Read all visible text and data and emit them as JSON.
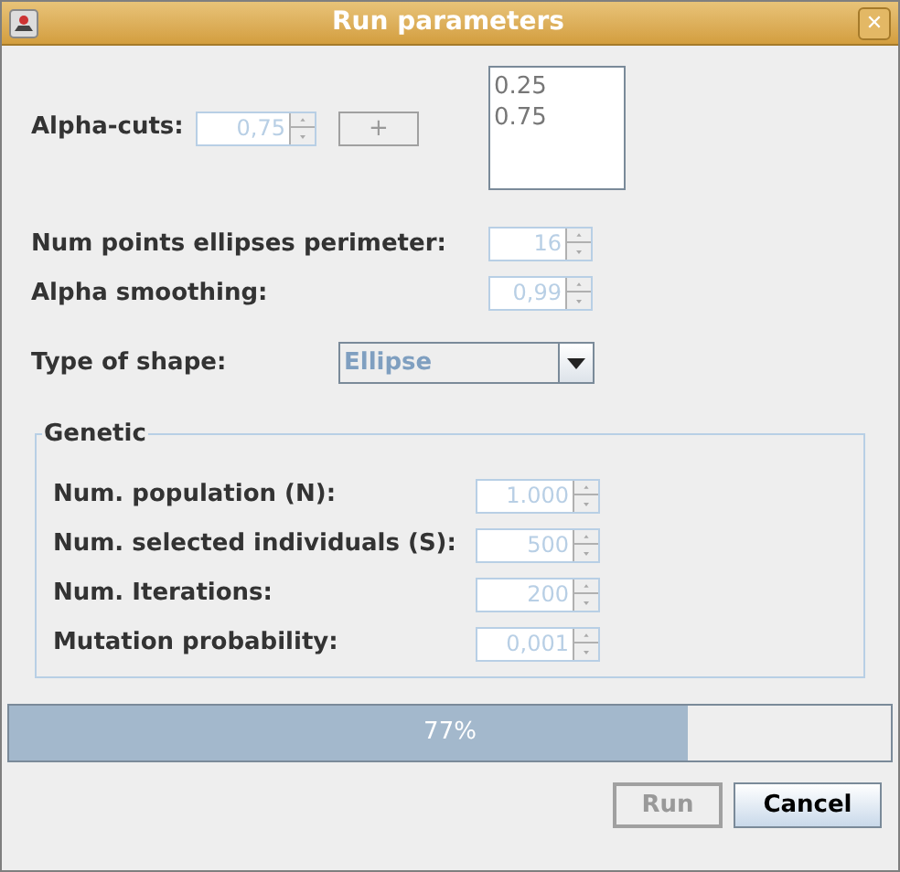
{
  "window": {
    "title": "Run parameters",
    "close": "✕"
  },
  "alpha_cuts": {
    "label": "Alpha-cuts:",
    "spinner": {
      "value": "0,75",
      "disabled": true
    },
    "add_button": {
      "label": "+",
      "disabled": true
    },
    "list": [
      "0.25",
      "0.75"
    ]
  },
  "params": [
    {
      "label": "Num points ellipses perimeter:",
      "value": "16",
      "disabled": true
    },
    {
      "label": "Alpha smoothing:",
      "value": "0,99",
      "disabled": true
    }
  ],
  "shape": {
    "label": "Type of shape:",
    "value": "Ellipse",
    "disabled": true
  },
  "genetic": {
    "title": "Genetic",
    "params": [
      {
        "label": "Num. population (N):",
        "value": "1.000",
        "disabled": true
      },
      {
        "label": "Num. selected individuals (S):",
        "value": "500",
        "disabled": true
      },
      {
        "label": "Num. Iterations:",
        "value": "200",
        "disabled": true
      },
      {
        "label": "Mutation probability:",
        "value": "0,001",
        "disabled": true
      }
    ]
  },
  "progress": {
    "level": 0.77,
    "text": "77%"
  },
  "buttons": [
    {
      "label": "Run",
      "disabled": true
    },
    {
      "label": "Cancel",
      "disabled": false
    }
  ]
}
